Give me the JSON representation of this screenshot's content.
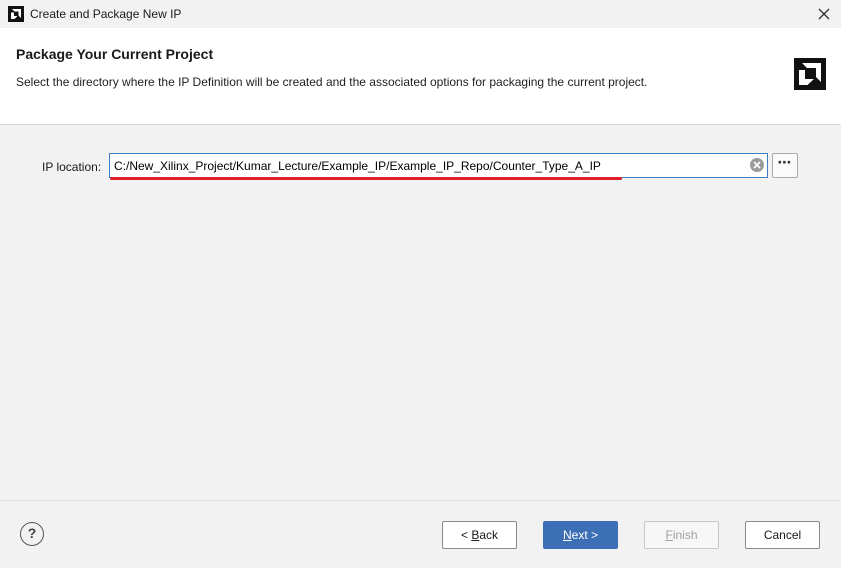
{
  "window": {
    "title": "Create and Package New IP",
    "icon": "amd-logo-icon",
    "close_icon": "close-icon"
  },
  "header": {
    "title": "Package Your Current Project",
    "description": "Select the directory where the IP Definition will be created and the associated options for packaging the current project.",
    "logo": "amd-logo-icon"
  },
  "form": {
    "ip_location_label": "IP location:",
    "ip_location_value": "C:/New_Xilinx_Project/Kumar_Lecture/Example_IP/Example_IP_Repo/Counter_Type_A_IP",
    "browse_label": "⋯",
    "clear_icon": "clear-icon"
  },
  "annotation": {
    "underline_color": "#e01e2c"
  },
  "footer": {
    "help_label": "?",
    "back": {
      "prefix": "< ",
      "mnemonic": "B",
      "rest": "ack"
    },
    "next": {
      "mnemonic": "N",
      "rest": "ext >"
    },
    "finish": {
      "mnemonic": "F",
      "rest": "inish"
    },
    "cancel_label": "Cancel"
  },
  "colors": {
    "accent": "#3d6fb6",
    "input_border": "#3d7fc4"
  }
}
